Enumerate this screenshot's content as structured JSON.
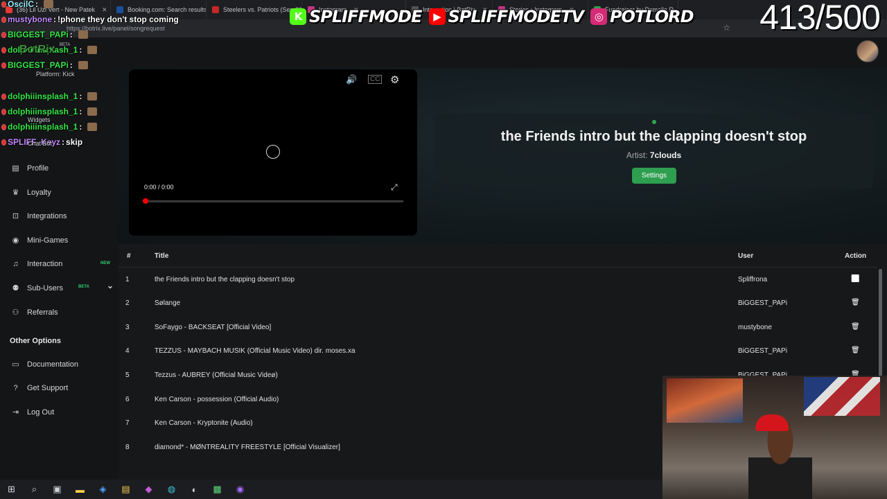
{
  "browser": {
    "tabs": [
      {
        "label": "(36) Lil Uzi Vert - New Patek",
        "color": "#e53935"
      },
      {
        "label": "Booking.com: Search results",
        "color": "#1a4f9c"
      },
      {
        "label": "Steelers vs. Patriots (Sep 20",
        "color": "#c62828"
      },
      {
        "label": "Instagram",
        "color": "#c13584"
      },
      {
        "label": "Interaction | BotRix",
        "color": "#555"
      },
      {
        "label": "Stories • Instagram",
        "color": "#c13584"
      },
      {
        "label": "Fundraiser by Pamalla R",
        "color": "#2e9e4f"
      }
    ],
    "url": "https://botrix.live/panel/songrequest"
  },
  "overlay": {
    "brands": [
      {
        "icon": "K",
        "icon_color": "#53fc18",
        "name": "SPLIFFMODE"
      },
      {
        "icon": "▶",
        "icon_color": "#ff0000",
        "name": "SPLIFFMODETV"
      },
      {
        "icon": "◎",
        "icon_color": "#d62976",
        "name": "POTLORD"
      }
    ],
    "counter": "413/500"
  },
  "chat": [
    {
      "user": "OscilC",
      "text": "",
      "color": "#9cf0ff"
    },
    {
      "user": "mustybone",
      "text": "!phone they don't stop coming",
      "color": "#c48bff"
    },
    {
      "user": "BIGGEST_PAPi",
      "text": "",
      "color": "#37e84a"
    },
    {
      "user": "dolphiiinsplash_1",
      "text": "",
      "color": "#37e84a"
    },
    {
      "user": "BIGGEST_PAPi",
      "text": "",
      "color": "#37e84a"
    },
    {
      "user": "dolphiiinsplash_1",
      "text": "",
      "color": "#37e84a"
    },
    {
      "user": "dolphiiinsplash_1",
      "text": "",
      "color": "#37e84a"
    },
    {
      "user": "dolphiiinsplash_1",
      "text": "",
      "color": "#37e84a"
    },
    {
      "user": "SPLIFF_Keyz",
      "text": "skip",
      "color": "#c48bff"
    }
  ],
  "sidebar_ghost": {
    "logo": "BotRix",
    "beta": "BETA",
    "platform": "Platform: Kick",
    "widgets": "Widgets",
    "chat_bot": "Chat Bot"
  },
  "sidebar": {
    "items": [
      {
        "label": "Profile",
        "icon": "id-card-icon",
        "glyph": "▤"
      },
      {
        "label": "Loyalty",
        "icon": "trophy-icon",
        "glyph": "♛"
      },
      {
        "label": "Integrations",
        "icon": "integrations-icon",
        "glyph": "⊡"
      },
      {
        "label": "Mini-Games",
        "icon": "gamepad-icon",
        "glyph": "◉"
      },
      {
        "label": "Interaction",
        "icon": "music-icon",
        "glyph": "♫",
        "badge": "NEW",
        "badge_color": "#2ecc71"
      },
      {
        "label": "Sub-Users",
        "icon": "users-icon",
        "glyph": "⚉",
        "badge": "BETA",
        "badge_color": "#2ecc71"
      },
      {
        "label": "Referrals",
        "icon": "referrals-icon",
        "glyph": "⚇"
      }
    ],
    "other_heading": "Other Options",
    "other_items": [
      {
        "label": "Documentation",
        "icon": "document-icon",
        "glyph": "▭"
      },
      {
        "label": "Get Support",
        "icon": "support-icon",
        "glyph": "?"
      },
      {
        "label": "Log Out",
        "icon": "logout-icon",
        "glyph": "⇥"
      }
    ]
  },
  "player": {
    "time": "0:00 / 0:00",
    "progress": 0
  },
  "now_playing": {
    "title": "the Friends intro but the clapping doesn't stop",
    "artist_label": "Artist:",
    "artist": "7clouds",
    "settings_label": "Settings",
    "accent": "#2e9e4f"
  },
  "queue": {
    "headers": {
      "num": "#",
      "title": "Title",
      "user": "User",
      "action": "Action"
    },
    "rows": [
      {
        "num": "1",
        "title": "the Friends intro but the clapping doesn't stop",
        "user": "Spliffrona",
        "action": "skip"
      },
      {
        "num": "2",
        "title": "Sølange",
        "user": "BiGGEST_PAPi",
        "action": "delete"
      },
      {
        "num": "3",
        "title": "SoFaygo - BACKSEAT [Official Video]",
        "user": "mustybone",
        "action": "delete"
      },
      {
        "num": "4",
        "title": "TEZZUS - MAYBACH MUSIK (Official Music Video) dir. moses.xa",
        "user": "BiGGEST_PAPi",
        "action": "delete"
      },
      {
        "num": "5",
        "title": "Tezzus - AUBREY (Official Music Videø)",
        "user": "BiGGEST_PAPi",
        "action": "delete"
      },
      {
        "num": "6",
        "title": "Ken Carson - possession (Official Audio)",
        "user": "",
        "action": ""
      },
      {
        "num": "7",
        "title": "Ken Carson - Kryptonite (Audio)",
        "user": "",
        "action": ""
      },
      {
        "num": "8",
        "title": "diamond* - MØNTREALITY FREESTYLE [Official Visualizer]",
        "user": "",
        "action": ""
      }
    ]
  }
}
